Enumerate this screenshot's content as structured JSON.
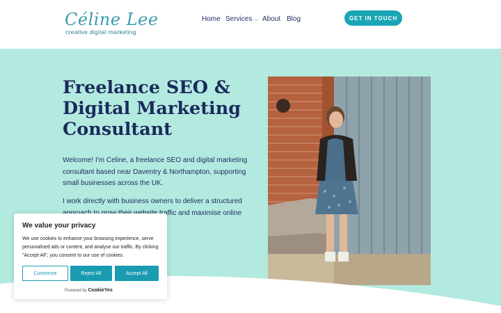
{
  "header": {
    "logo_script": "Céline Lee",
    "logo_tagline": "creative digital marketing",
    "nav": {
      "home": "Home",
      "services": "Services",
      "about": "About",
      "blog": "Blog"
    },
    "cta_label": "GET IN TOUCH"
  },
  "hero": {
    "title_line1": "Freelance SEO &",
    "title_line2": "Digital Marketing",
    "title_line3": "Consultant",
    "intro": "Welcome! I'm Celine, a freelance SEO and digital marketing consultant based near Daventry & Northampton, supporting small businesses across the UK.",
    "intro2": "I work directly with business owners to deliver a structured approach to grow their website traffic and maximise online"
  },
  "cookie": {
    "title": "We value your privacy",
    "text": "We use cookies to enhance your browsing experience, serve personalised ads or content, and analyse our traffic. By clicking \"Accept All\", you consent to our use of cookies.",
    "customise": "Customise",
    "reject": "Reject All",
    "accept": "Accept All",
    "powered_by": "Powered by",
    "powered_brand": "CookieYes"
  },
  "colors": {
    "accent": "#1aa5b5",
    "hero_bg": "#b3eae0",
    "navy": "#1b2a5c"
  }
}
